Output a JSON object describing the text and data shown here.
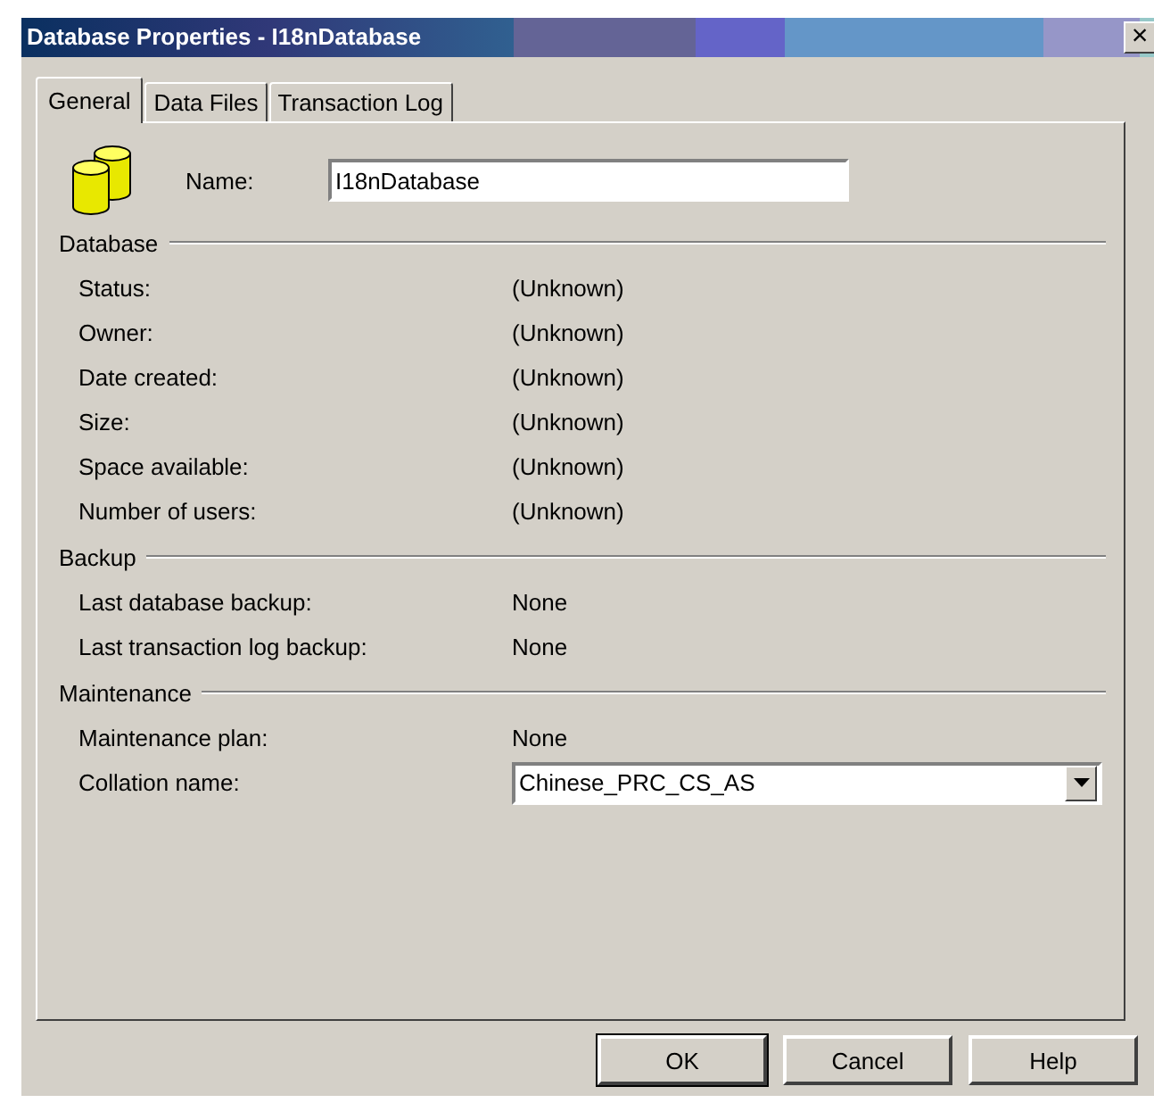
{
  "window": {
    "title": "Database Properties - I18nDatabase",
    "close": "×"
  },
  "tabs": [
    {
      "label": "General",
      "selected": true
    },
    {
      "label": "Data Files",
      "selected": false
    },
    {
      "label": "Transaction Log",
      "selected": false
    }
  ],
  "name_field": {
    "label": "Name:",
    "value": "I18nDatabase"
  },
  "sections": [
    {
      "title": "Database",
      "rows": [
        {
          "label": "Status:",
          "value": "(Unknown)",
          "kind": "text"
        },
        {
          "label": "Owner:",
          "value": "(Unknown)",
          "kind": "text"
        },
        {
          "label": "Date created:",
          "value": "(Unknown)",
          "kind": "text"
        },
        {
          "label": "Size:",
          "value": "(Unknown)",
          "kind": "text"
        },
        {
          "label": "Space available:",
          "value": "(Unknown)",
          "kind": "text"
        },
        {
          "label": "Number of users:",
          "value": "(Unknown)",
          "kind": "text"
        }
      ]
    },
    {
      "title": "Backup",
      "rows": [
        {
          "label": "Last database backup:",
          "value": "None",
          "kind": "text"
        },
        {
          "label": "Last transaction log backup:",
          "value": "None",
          "kind": "text"
        }
      ]
    },
    {
      "title": "Maintenance",
      "rows": [
        {
          "label": "Maintenance plan:",
          "value": "None",
          "kind": "text"
        },
        {
          "label": "Collation name:",
          "value": "Chinese_PRC_CS_AS",
          "kind": "dropdown"
        }
      ]
    }
  ],
  "buttons": [
    {
      "label": "OK",
      "default": true
    },
    {
      "label": "Cancel",
      "default": false
    },
    {
      "label": "Help",
      "default": false
    }
  ]
}
